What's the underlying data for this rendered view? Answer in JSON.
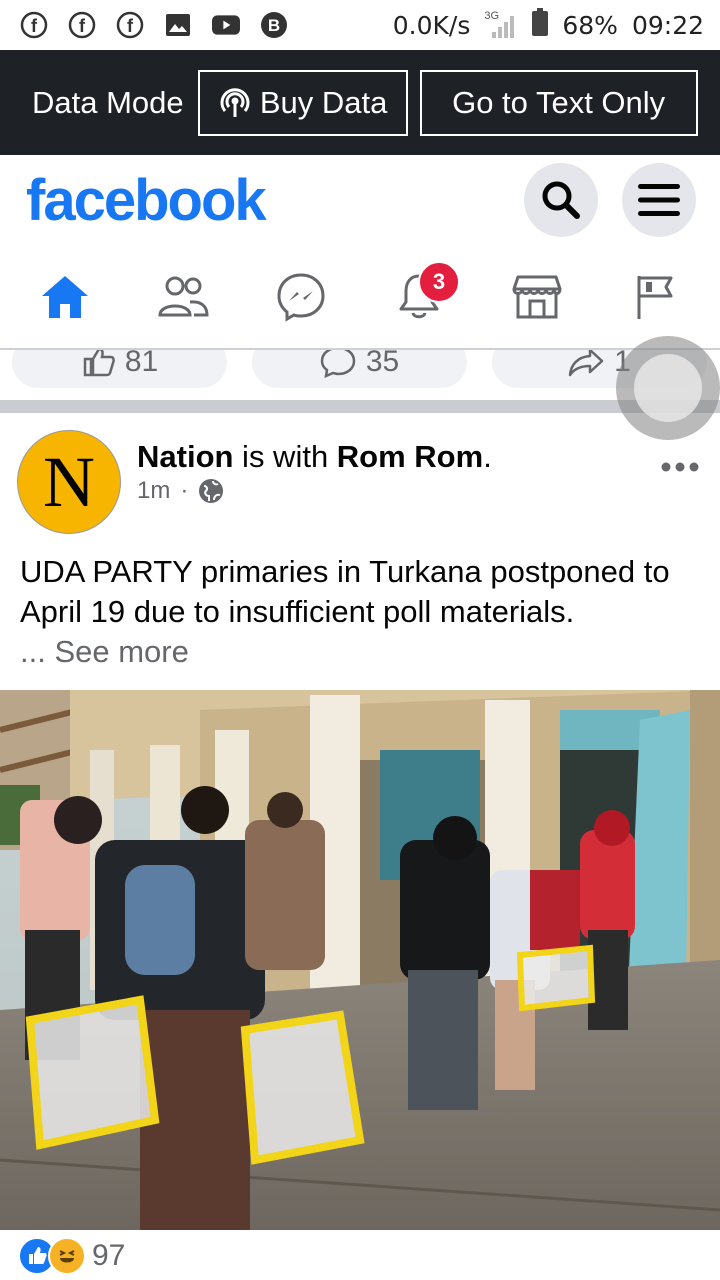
{
  "status_bar": {
    "net_speed": "0.0K/s",
    "network": "3G",
    "battery": "68%",
    "time": "09:22",
    "left_icons": [
      "facebook-notification-icon",
      "facebook-notification-icon",
      "facebook-notification-icon",
      "gallery-icon",
      "youtube-icon",
      "b-app-icon"
    ]
  },
  "data_bar": {
    "label": "Data Mode",
    "buy_label": "Buy Data",
    "text_only_label": "Go to Text Only"
  },
  "header": {
    "logo": "facebook"
  },
  "nav": {
    "notifications_badge": "3"
  },
  "prev_post": {
    "likes": "81",
    "comments": "35",
    "shares": "1"
  },
  "post": {
    "avatar_letter": "N",
    "author": "Nation",
    "with_text": " is with ",
    "tagged": "Rom Rom",
    "time": "1m",
    "dot": "·",
    "text": "UDA PARTY primaries in Turkana postponed to April 19 due to insufficient poll materials.",
    "see_more": "... See more",
    "reaction_count": "97"
  },
  "colors": {
    "brand": "#1877f2",
    "data_bar_bg": "#1e2125",
    "badge": "#e41e3f"
  }
}
